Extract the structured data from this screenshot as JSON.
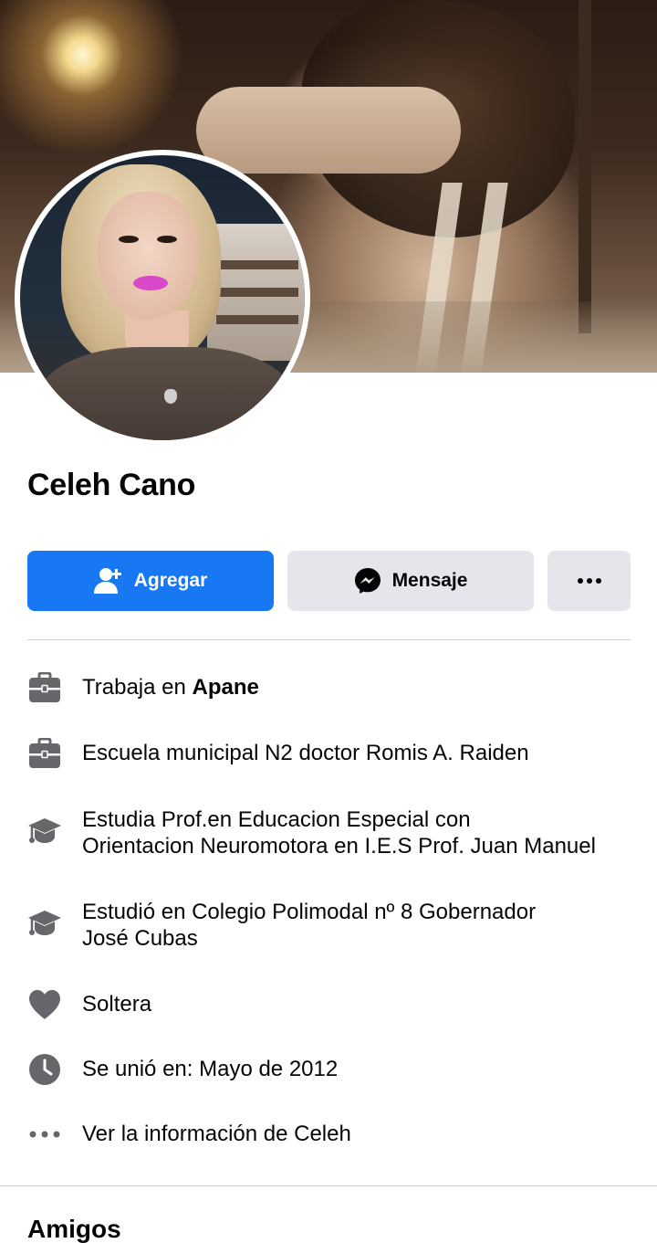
{
  "profile": {
    "name": "Celeh Cano"
  },
  "actions": {
    "add_label": "Agregar",
    "message_label": "Mensaje",
    "more_icon": "more-horizontal-icon"
  },
  "info": {
    "work_prefix": "Trabaja en ",
    "work_place": "Apane",
    "work2": "Escuela municipal N2 doctor Romis A. Raiden",
    "study_line1": "Estudia Prof.en Educacion Especial con",
    "study_line2": "Orientacion Neuromotora en I.E.S Prof. Juan Manuel",
    "studied_line1": "Estudió en Colegio Polimodal nº 8 Gobernador",
    "studied_line2": "José Cubas",
    "relationship": "Soltera",
    "joined": "Se unió en: Mayo de 2012",
    "see_more": "Ver la información de Celeh"
  },
  "friends": {
    "title": "Amigos"
  },
  "colors": {
    "primary": "#1877f2",
    "secondary_button": "#e4e6eb",
    "icon_gray": "#65676b",
    "divider": "#ced0d4"
  }
}
